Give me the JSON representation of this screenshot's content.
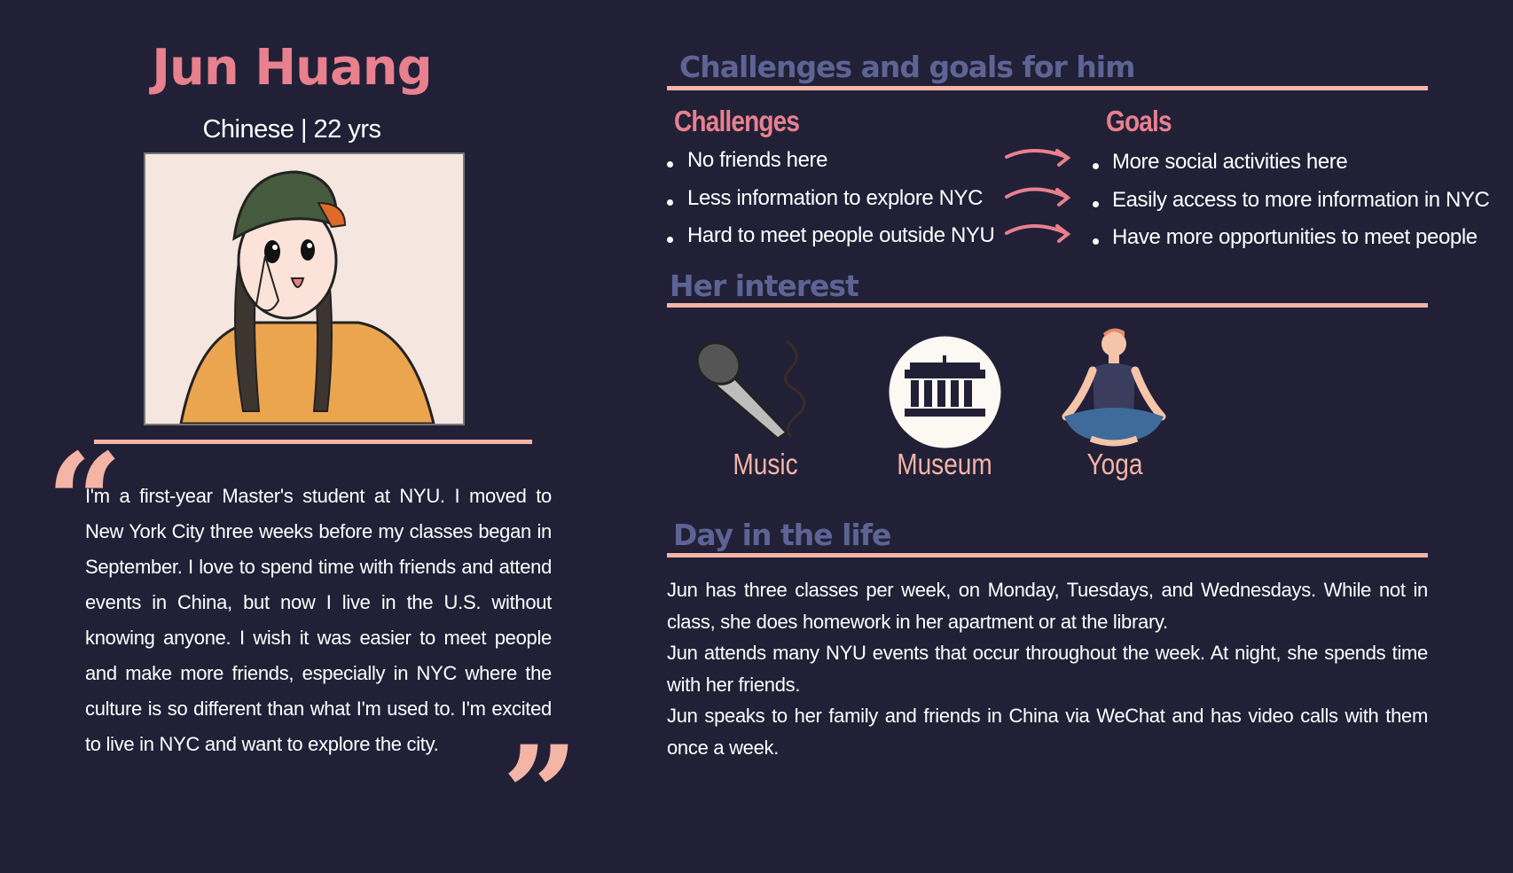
{
  "profile": {
    "name": "Jun Huang",
    "subtitle": "Chinese | 22 yrs",
    "quote_open": "“",
    "quote_close": "”",
    "bio": "I'm a first-year Master's student at NYU. I moved to New York City three weeks before my classes began in September. I love to spend time with friends and attend events in China, but now I live in the U.S. without knowing anyone. I wish it was easier to meet people and make more friends, especially in NYC where the culture is so different than what I'm used to. I'm excited to live in NYC and want to explore the city."
  },
  "challenges_section": {
    "title": "Challenges and goals for him",
    "challenges_heading": "Challenges",
    "goals_heading": "Goals",
    "challenges": [
      "No friends here",
      "Less information to explore NYC",
      "Hard to meet people outside NYU"
    ],
    "goals": [
      "More social activities here",
      "Easily access to more information in NYC",
      "Have more opportunities to meet people"
    ]
  },
  "interest_section": {
    "title": "Her interest",
    "items": [
      {
        "label": "Music",
        "icon": "microphone-icon"
      },
      {
        "label": "Museum",
        "icon": "museum-icon"
      },
      {
        "label": "Yoga",
        "icon": "yoga-icon"
      }
    ]
  },
  "day_section": {
    "title": "Day in the life",
    "paragraphs": [
      "Jun has three classes per week, on Monday, Tuesdays, and Wednesdays. While not in class, she does homework in her apartment or at the library.",
      "Jun attends many NYU events that occur throughout the week. At night, she spends time with her friends.",
      "Jun speaks to her family and friends in China via WeChat and has video calls with them once a week."
    ]
  },
  "colors": {
    "background": "#212037",
    "accent_pink": "#e8808e",
    "rule_peach": "#f4b4a6",
    "heading_slate": "#5d6494"
  }
}
